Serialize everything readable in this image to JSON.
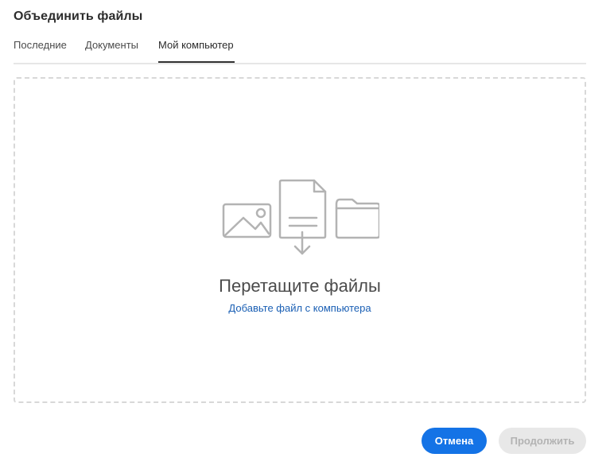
{
  "dialog": {
    "title": "Объединить файлы"
  },
  "tabs": [
    {
      "label": "Последние",
      "selected": false
    },
    {
      "label": "Документы",
      "selected": false
    },
    {
      "label": "Мой компьютер",
      "selected": true
    }
  ],
  "dropzone": {
    "title": "Перетащите файлы",
    "add_link": "Добавьте файл с компьютера",
    "icons": [
      "image-icon",
      "document-upload-icon",
      "folder-icon"
    ]
  },
  "buttons": {
    "cancel_label": "Отмена",
    "continue_label": "Продолжить",
    "continue_disabled": true
  },
  "colors": {
    "primary": "#1473e6",
    "link": "#1a5fb4",
    "disabled_bg": "#e8e8e8",
    "disabled_text": "#b3b3b3",
    "icon_stroke": "#b3b3b3"
  }
}
